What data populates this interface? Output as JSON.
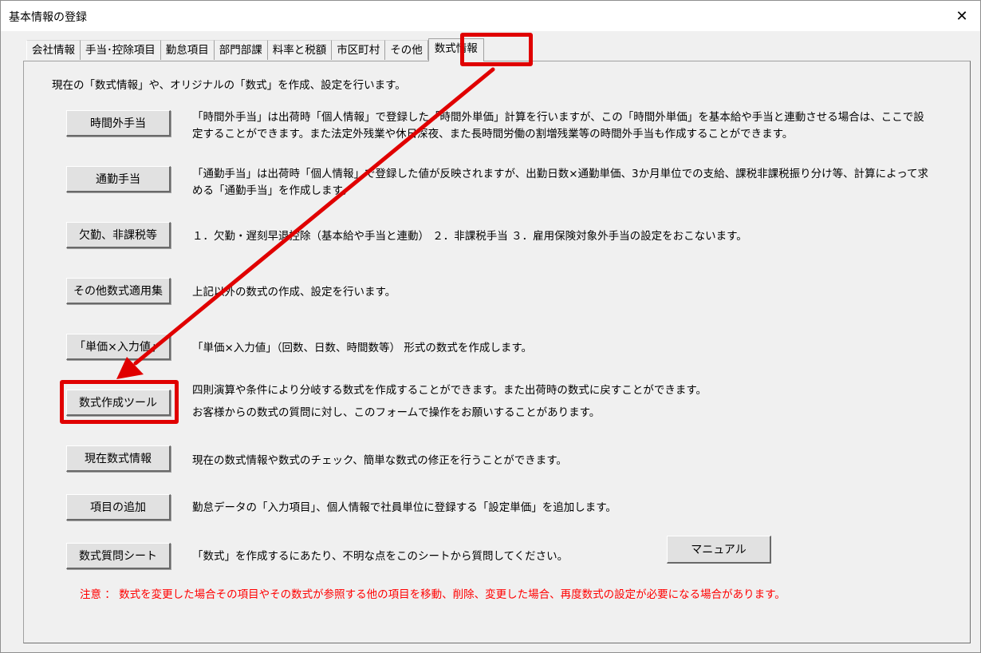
{
  "window": {
    "title": "基本情報の登録",
    "close_icon": "close-icon"
  },
  "tabs": [
    {
      "label": "会社情報"
    },
    {
      "label": "手当･控除項目"
    },
    {
      "label": "勤怠項目"
    },
    {
      "label": "部門部課"
    },
    {
      "label": "料率と税額"
    },
    {
      "label": "市区町村"
    },
    {
      "label": "その他"
    },
    {
      "label": "数式情報",
      "active": true
    }
  ],
  "intro": "現在の「数式情報」や、オリジナルの「数式」を作成、設定を行います。",
  "rows": [
    {
      "button": "時間外手当",
      "desc": "「時間外手当」は出荷時「個人情報」で登録した「時間外単価」計算を行いますが、この「時間外単価」を基本給や手当と連動させる場合は、ここで設定することができます。また法定外残業や休日深夜、また長時間労働の割増残業等の時間外手当も作成することができます。"
    },
    {
      "button": "通勤手当",
      "desc": "「通勤手当」は出荷時「個人情報」で登録した値が反映されますが、出勤日数×通勤単価、3か月単位での支給、課税非課税振り分け等、計算によって求める「通勤手当」を作成します。"
    },
    {
      "button": "欠勤、非課税等",
      "desc": "１．欠勤・遅刻早退控除（基本給や手当と連動） ２．非課税手当 ３．雇用保険対象外手当の設定をおこないます。"
    },
    {
      "button": "その他数式適用集",
      "desc": "上記以外の数式の作成、設定を行います。"
    },
    {
      "button": "「単価×入力値」",
      "desc": "「単価×入力値」（回数、日数、時間数等） 形式の数式を作成します。"
    },
    {
      "button": "数式作成ツール",
      "desc": "四則演算や条件により分岐する数式を作成することができます。また出荷時の数式に戻すことができます。",
      "desc2": "お客様からの数式の質問に対し、このフォームで操作をお願いすることがあります。"
    },
    {
      "button": "現在数式情報",
      "desc": "現在の数式情報や数式のチェック、簡単な数式の修正を行うことができます。"
    },
    {
      "button": "項目の追加",
      "desc": "勤怠データの「入力項目」、個人情報で社員単位に登録する「設定単価」を追加します。"
    },
    {
      "button": "数式質問シート",
      "desc": "「数式」を作成するにあたり、不明な点をこのシートから質問してください。"
    }
  ],
  "manual_button": "マニュアル",
  "note": "注意 ： 数式を変更した場合その項目やその数式が参照する他の項目を移動、削除、変更した場合、再度数式の設定が必要になる場合があります。",
  "colors": {
    "highlight": "#e00000",
    "note": "#ff0000",
    "background": "#f0f0f0"
  }
}
